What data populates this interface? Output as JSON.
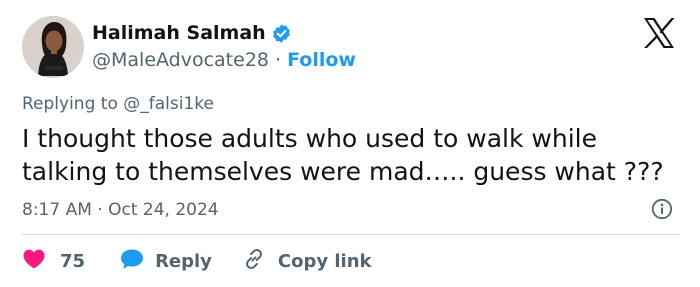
{
  "user": {
    "display_name": "Halimah Salmah",
    "handle": "@MaleAdvocate28",
    "separator": "·",
    "follow_label": "Follow"
  },
  "icons": {
    "avatar": "profile-photo",
    "verified": "verified-badge-icon",
    "brand": "x-logo-icon",
    "info": "info-icon",
    "like": "heart-icon",
    "reply": "speech-bubble-icon",
    "copy": "link-icon"
  },
  "tweet": {
    "replying_prefix": "Replying to ",
    "replying_to": "@_falsi1ke",
    "text": "I thought those adults who used to walk while\ntalking to themselves were mad….. guess what ???",
    "time": "8:17 AM",
    "meta_separator": " · ",
    "date": "Oct 24, 2024"
  },
  "actions": {
    "like_count": "75",
    "reply_label": "Reply",
    "copy_label": "Copy link"
  },
  "colors": {
    "accent": "#1d9bf0",
    "like": "#f91880",
    "muted_text": "#536471",
    "primary_text": "#0f1419"
  }
}
